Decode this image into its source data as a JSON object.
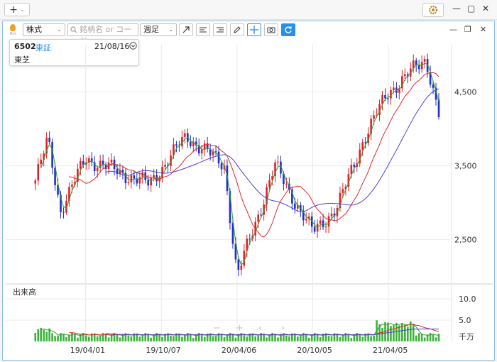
{
  "app": {
    "add_tab_label": "+",
    "settings_icon": "gear-icon"
  },
  "toolbar": {
    "category_select": "株式",
    "search_placeholder": "銘柄名 or コード",
    "period_select": "週足"
  },
  "stock": {
    "code": "6502",
    "market": "東証",
    "date": "21/08/16",
    "name": "東芝"
  },
  "chart_data": {
    "type": "candlestick",
    "price_axis": {
      "ticks": [
        "4,500",
        "3,500",
        "2,500"
      ],
      "tick_values": [
        4500,
        3500,
        2500
      ],
      "ylim": [
        1900,
        5100
      ]
    },
    "volume_axis": {
      "label": "出来高",
      "ticks": [
        "10.0",
        "5.0"
      ],
      "tick_values": [
        10.0,
        5.0
      ],
      "unit": "千万"
    },
    "x_tick_labels": [
      "19/04/01",
      "19/10/07",
      "20/04/06",
      "20/10/05",
      "21/04/05"
    ],
    "key_points": [
      {
        "date": "2018/12",
        "price": 3300
      },
      {
        "date": "2019/01",
        "price": 3850
      },
      {
        "date": "2019/02",
        "price": 2900
      },
      {
        "date": "2019/04",
        "price": 3600
      },
      {
        "date": "2019/09",
        "price": 3250
      },
      {
        "date": "2019/12",
        "price": 3900
      },
      {
        "date": "2020/03",
        "price": 3500
      },
      {
        "date": "2020/04",
        "price": 2000
      },
      {
        "date": "2020/07",
        "price": 3500
      },
      {
        "date": "2020/10",
        "price": 2600
      },
      {
        "date": "2020/12",
        "price": 2950
      },
      {
        "date": "2021/02",
        "price": 3850
      },
      {
        "date": "2021/04",
        "price": 4500
      },
      {
        "date": "2021/07",
        "price": 4950
      },
      {
        "date": "2021/08",
        "price": 4200
      }
    ],
    "colors": {
      "up": "#e0202a",
      "down": "#1f2fc8",
      "ma_short": "#2ea02e",
      "ma_mid": "#e02626",
      "ma_long": "#4b3fd0",
      "volume": "#3cb33c"
    }
  },
  "nav_controls": [
    "−",
    "+",
    "‹",
    "›"
  ]
}
